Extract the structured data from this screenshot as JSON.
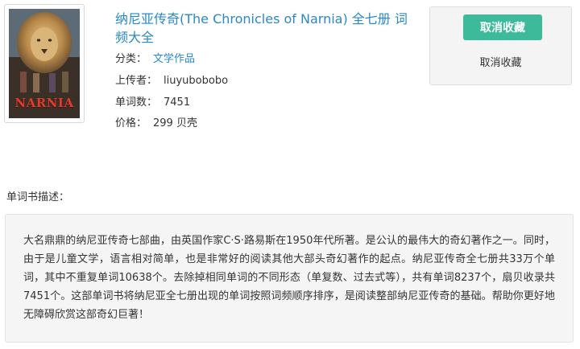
{
  "book": {
    "title": "纳尼亚传奇(The Chronicles of Narnia) 全七册 词频大全",
    "cover_text": "NARNIA",
    "category_label": "分类：",
    "category_value": "文学作品",
    "uploader_label": "上传者：",
    "uploader_value": "liuyubobobo",
    "wordcount_label": "单词数：",
    "wordcount_value": "7451",
    "price_label": "价格：",
    "price_value": "299 贝壳"
  },
  "actions": {
    "unfavorite_button": "取消收藏",
    "unfavorite_link": "取消收藏"
  },
  "description": {
    "label": "单词书描述：",
    "text": "大名鼎鼎的纳尼亚传奇七部曲，由英国作家C·S·路易斯在1950年代所著。是公认的最伟大的奇幻著作之一。同时，由于是儿童文学，语言相对简单，也是非常好的阅读其他大部头奇幻著作的起点。纳尼亚传奇全七册共33万个单词，其中不重复单词10638个。去除掉相同单词的不同形态（单复数、过去式等），共有单词8237个，扇贝收录共7451个。这部单词书将纳尼亚全七册出现的单词按照词频顺序排序，是阅读整部纳尼亚传奇的基础。帮助你更好地无障碍欣赏这部奇幻巨著！"
  },
  "colors": {
    "accent": "#2a88c8",
    "button": "#3cba9a",
    "panel": "#f4f4f4"
  }
}
